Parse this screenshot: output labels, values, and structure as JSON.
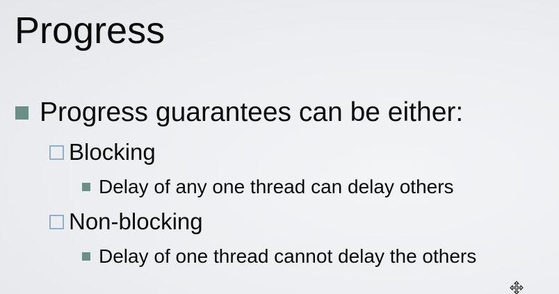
{
  "slide": {
    "title": "Progress",
    "bullets": [
      {
        "text": "Progress guarantees can be either:",
        "children": [
          {
            "text": "Blocking",
            "children": [
              {
                "text": "Delay of any one thread can delay others"
              }
            ]
          },
          {
            "text": "Non-blocking",
            "children": [
              {
                "text": "Delay of one thread cannot delay the others"
              }
            ]
          }
        ]
      }
    ]
  },
  "colors": {
    "level1_bullet": "#6b8f86",
    "level2_bullet_border": "#8fb0c6",
    "level3_bullet": "#6b8f86",
    "text": "#0a0a0a"
  },
  "icons": {
    "cursor": "move-cursor-icon"
  }
}
